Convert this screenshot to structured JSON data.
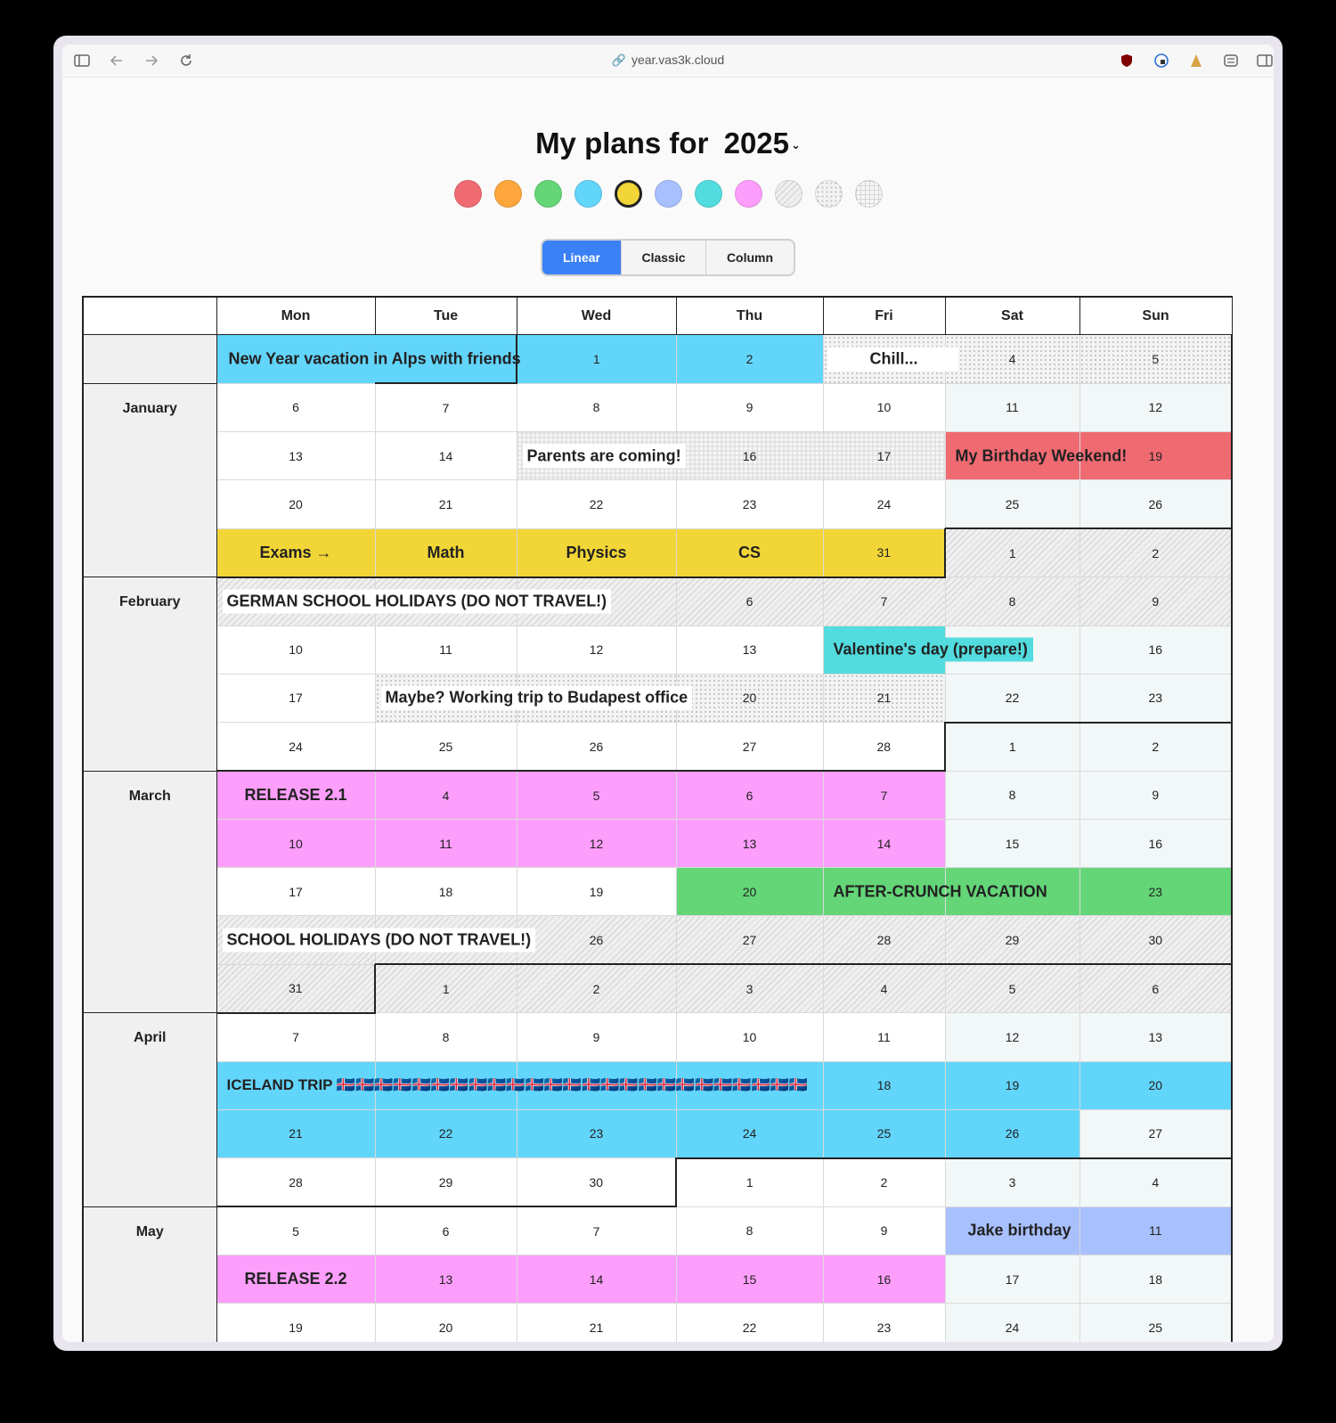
{
  "browser": {
    "url": "year.vas3k.cloud",
    "icons": [
      "sidebar-icon",
      "back-icon",
      "forward-icon",
      "reload-icon",
      "ublock-icon",
      "password-icon",
      "extension-icon",
      "tab-icon",
      "split-view-icon"
    ]
  },
  "title": {
    "prefix": "My plans for",
    "year": "2025",
    "caret": "⌄"
  },
  "colors": [
    "#f06a72",
    "#fca63c",
    "#64d678",
    "#62d5fb",
    "#f2d637",
    "#a8c0fd",
    "#52dcdf",
    "#fd9efc",
    "hatch",
    "dots",
    "grid"
  ],
  "selected_color": "#f2d637",
  "views": {
    "linear": "Linear",
    "classic": "Classic",
    "column": "Column",
    "active": "Linear"
  },
  "weekdays": [
    "Mon",
    "Tue",
    "Wed",
    "Thu",
    "Fri",
    "Sat",
    "Sun"
  ],
  "months": {
    "jan": "January",
    "feb": "February",
    "mar": "March",
    "apr": "April",
    "may": "May"
  },
  "events": {
    "new_year": "New Year vacation in Alps with friends",
    "chill": "Chill...",
    "parents": "Parents are coming!",
    "birthday": "My Birthday Weekend!",
    "exams": "Exams →",
    "math": "Math",
    "physics": "Physics",
    "cs": "CS",
    "german_holidays": "GERMAN SCHOOL HOLIDAYS (DO NOT TRAVEL!)",
    "valentine": "Valentine's day (prepare!)",
    "budapest": "Maybe? Working trip to Budapest office",
    "release21": "RELEASE 2.1",
    "after_crunch": "AFTER-CRUNCH VACATION",
    "school_holidays": "SCHOOL HOLIDAYS (DO NOT TRAVEL!)",
    "iceland": "ICELAND TRIP 🇮🇸🇮🇸🇮🇸🇮🇸🇮🇸🇮🇸🇮🇸🇮🇸🇮🇸🇮🇸🇮🇸🇮🇸🇮🇸🇮🇸🇮🇸🇮🇸🇮🇸🇮🇸🇮🇸🇮🇸🇮🇸🇮🇸🇮🇸🇮🇸🇮🇸",
    "jake": "Jake birthday",
    "release22": "RELEASE 2.2"
  },
  "rows": [
    {
      "m": "",
      "days": [
        "",
        "",
        "1",
        "2",
        "",
        "4",
        "5"
      ]
    },
    {
      "m": "jan",
      "days": [
        "6",
        "7",
        "8",
        "9",
        "10",
        "11",
        "12"
      ]
    },
    {
      "m": "",
      "days": [
        "13",
        "14",
        "",
        "16",
        "17",
        "",
        "19"
      ]
    },
    {
      "m": "",
      "days": [
        "20",
        "21",
        "22",
        "23",
        "24",
        "25",
        "26"
      ]
    },
    {
      "m": "",
      "days": [
        "",
        "",
        "",
        "",
        "31",
        "1",
        "2"
      ]
    },
    {
      "m": "feb",
      "days": [
        "",
        "",
        "",
        "6",
        "7",
        "8",
        "9"
      ]
    },
    {
      "m": "",
      "days": [
        "10",
        "11",
        "12",
        "13",
        "",
        "",
        "16"
      ]
    },
    {
      "m": "",
      "days": [
        "17",
        "",
        "",
        "20",
        "21",
        "22",
        "23"
      ]
    },
    {
      "m": "",
      "days": [
        "24",
        "25",
        "26",
        "27",
        "28",
        "1",
        "2"
      ]
    },
    {
      "m": "mar",
      "days": [
        "",
        "4",
        "5",
        "6",
        "7",
        "8",
        "9"
      ]
    },
    {
      "m": "",
      "days": [
        "10",
        "11",
        "12",
        "13",
        "14",
        "15",
        "16"
      ]
    },
    {
      "m": "",
      "days": [
        "17",
        "18",
        "19",
        "20",
        "",
        "",
        "23"
      ]
    },
    {
      "m": "",
      "days": [
        "",
        "",
        "26",
        "27",
        "28",
        "29",
        "30"
      ]
    },
    {
      "m": "",
      "days": [
        "31",
        "1",
        "2",
        "3",
        "4",
        "5",
        "6"
      ]
    },
    {
      "m": "apr",
      "days": [
        "7",
        "8",
        "9",
        "10",
        "11",
        "12",
        "13"
      ]
    },
    {
      "m": "",
      "days": [
        "",
        "",
        "",
        "",
        "18",
        "19",
        "20"
      ]
    },
    {
      "m": "",
      "days": [
        "21",
        "22",
        "23",
        "24",
        "25",
        "26",
        "27"
      ]
    },
    {
      "m": "",
      "days": [
        "28",
        "29",
        "30",
        "1",
        "2",
        "3",
        "4"
      ]
    },
    {
      "m": "may",
      "days": [
        "5",
        "6",
        "7",
        "8",
        "9",
        "",
        "11"
      ]
    },
    {
      "m": "",
      "days": [
        "",
        "13",
        "14",
        "15",
        "16",
        "17",
        "18"
      ]
    },
    {
      "m": "",
      "days": [
        "19",
        "20",
        "21",
        "22",
        "23",
        "24",
        "25"
      ]
    }
  ]
}
